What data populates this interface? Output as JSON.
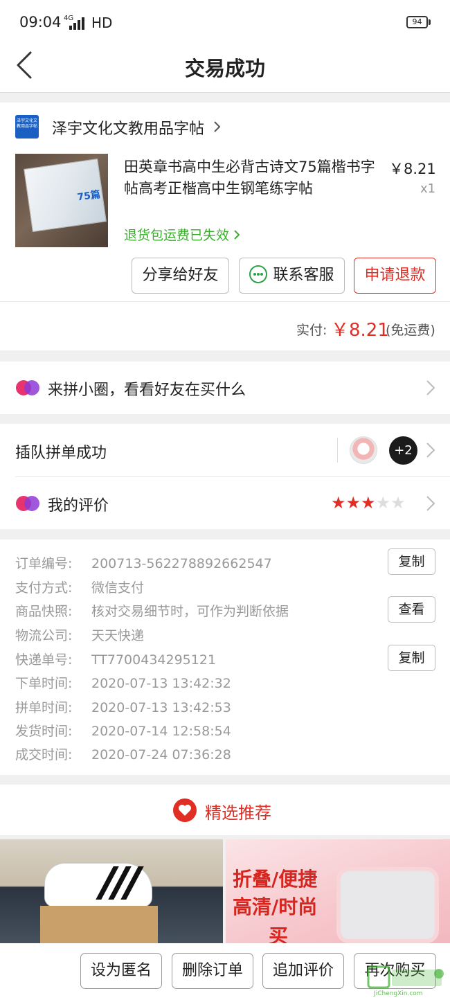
{
  "status_bar": {
    "time": "09:04",
    "network": "4G",
    "hd": "HD",
    "battery": "94"
  },
  "nav": {
    "title": "交易成功"
  },
  "order": {
    "shop_logo_text": "泽宇文化文教用品字帖",
    "shop_name": "泽宇文化文教用品字帖",
    "product_image_text": "75篇",
    "product_title": "田英章书高中生必背古诗文75篇楷书字帖高考正楷高中生钢笔练字帖",
    "price": "￥8.21",
    "quantity": "x1",
    "refund_shipping_note": "退货包运费已失效",
    "buttons": {
      "share": "分享给好友",
      "service": "联系客服",
      "refund": "申请退款"
    },
    "paid_label": "实付:",
    "paid_amount": "￥8.21",
    "paid_note": "(免运费)"
  },
  "pin_circle": {
    "text": "来拼小圈，看看好友在买什么"
  },
  "group": {
    "text": "插队拼单成功",
    "extra_count": "+2"
  },
  "review": {
    "text": "我的评价",
    "rating": 3,
    "max": 5
  },
  "info": {
    "order_no_label": "订单编号:",
    "order_no": "200713-562278892662547",
    "pay_label": "支付方式:",
    "pay": "微信支付",
    "snapshot_label": "商品快照:",
    "snapshot": "核对交易细节时，可作为判断依据",
    "logistics_label": "物流公司:",
    "logistics": "天天快递",
    "tracking_label": "快递单号:",
    "tracking": "TT7700434295121",
    "order_time_label": "下单时间:",
    "order_time": "2020-07-13 13:42:32",
    "group_time_label": "拼单时间:",
    "group_time": "2020-07-13 13:42:53",
    "ship_time_label": "发货时间:",
    "ship_time": "2020-07-14 12:58:54",
    "deal_time_label": "成交时间:",
    "deal_time": "2020-07-24 07:36:28",
    "copy_label": "复制",
    "view_label": "查看"
  },
  "recommend": {
    "title": "精选推荐",
    "promo_line1": "折叠/便捷",
    "promo_line2": "高清/时尚",
    "promo_line3": "买"
  },
  "bottom": {
    "anon": "设为匿名",
    "delete": "删除订单",
    "add_review": "追加评价",
    "rebuy": "再次购买"
  },
  "watermark": {
    "text": "JiChengXin.com"
  },
  "colors": {
    "accent": "#e02e24",
    "green": "#3aae2c",
    "star": "#e02e24"
  }
}
